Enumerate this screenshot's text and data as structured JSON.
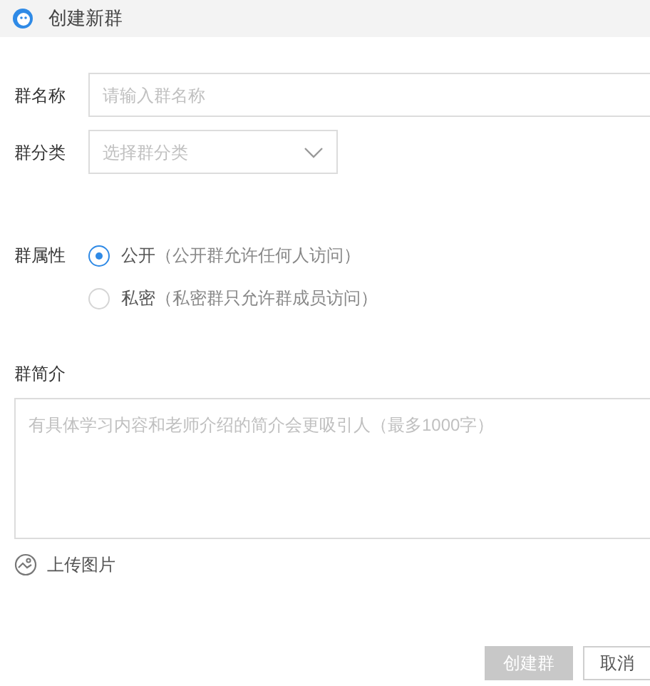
{
  "window": {
    "title": "创建新群"
  },
  "name_field": {
    "label": "群名称",
    "placeholder": "请输入群名称"
  },
  "category_field": {
    "label": "群分类",
    "placeholder": "选择群分类"
  },
  "privacy": {
    "label": "群属性",
    "options": [
      {
        "label": "公开",
        "hint": "（公开群允许任何人访问）",
        "selected": true
      },
      {
        "label": "私密",
        "hint": "（私密群只允许群成员访问）",
        "selected": false
      }
    ]
  },
  "intro": {
    "label": "群简介",
    "placeholder": "有具体学习内容和老师介绍的简介会更吸引人（最多1000字）"
  },
  "upload": {
    "label": "上传图片"
  },
  "buttons": [
    {
      "label": "创建群",
      "kind": "primary",
      "disabled": true
    },
    {
      "label": "取消",
      "kind": "secondary",
      "disabled": false
    }
  ]
}
